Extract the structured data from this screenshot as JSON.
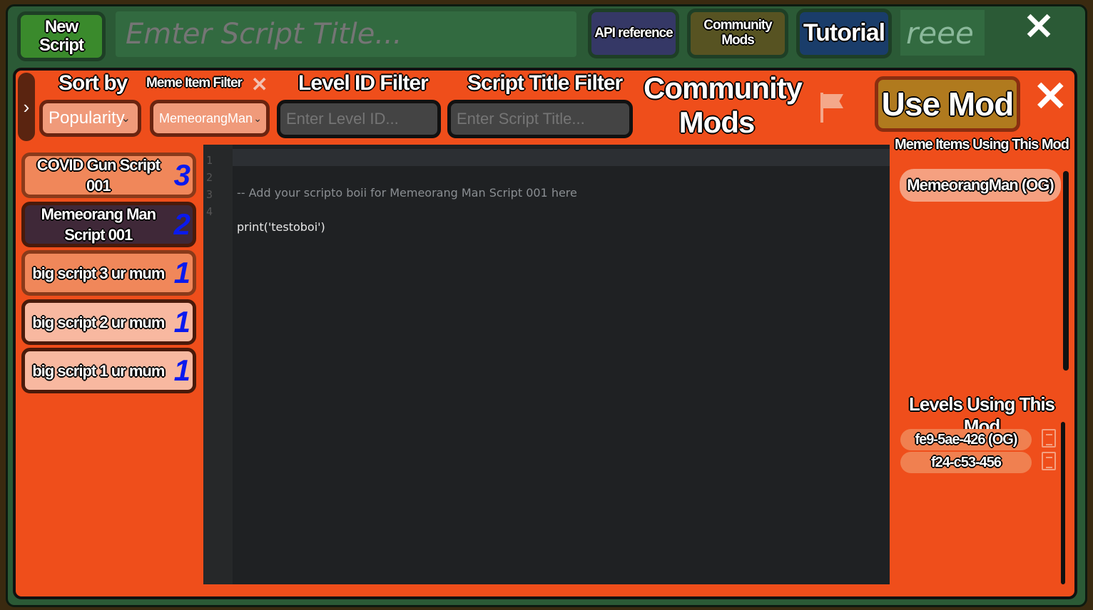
{
  "toolbar": {
    "new_script": "New Script",
    "title_placeholder": "Emter Script Title...",
    "api_reference": "API reference",
    "community_mods": "Community Mods",
    "tutorial": "Tutorial",
    "reee": "reee"
  },
  "filters": {
    "sort_by_label": "Sort by",
    "sort_value": "Popularity",
    "meme_item_filter_label": "Meme Item Filter",
    "meme_item_value": "MemeorangMan",
    "level_id_label": "Level ID Filter",
    "level_id_placeholder": "Enter Level ID...",
    "script_title_label": "Script Title Filter",
    "script_title_placeholder": "Enter Script Title..."
  },
  "panel": {
    "title": "Community Mods",
    "use_mod": "Use Mod"
  },
  "scripts": [
    {
      "title": "COVID Gun Script 001",
      "votes": "3"
    },
    {
      "title": "Memeorang Man Script 001",
      "votes": "2"
    },
    {
      "title": "big script 3 ur mum",
      "votes": "1"
    },
    {
      "title": "big script 2 ur mum",
      "votes": "1"
    },
    {
      "title": "big script 1 ur mum",
      "votes": "1"
    }
  ],
  "editor": {
    "line_numbers": [
      "1",
      "2",
      "3",
      "4"
    ],
    "lines": [
      "-- Add your scripto boii for Memeorang Man Script 001 here",
      "",
      "print('testoboi')",
      ""
    ]
  },
  "right": {
    "meme_items_label": "Meme Items Using This Mod",
    "meme_items": [
      "MemeorangMan (OG)"
    ],
    "levels_label": "Levels Using This Mod",
    "levels": [
      "fe9-5ae-426 (OG)",
      "f24-c53-456"
    ]
  }
}
